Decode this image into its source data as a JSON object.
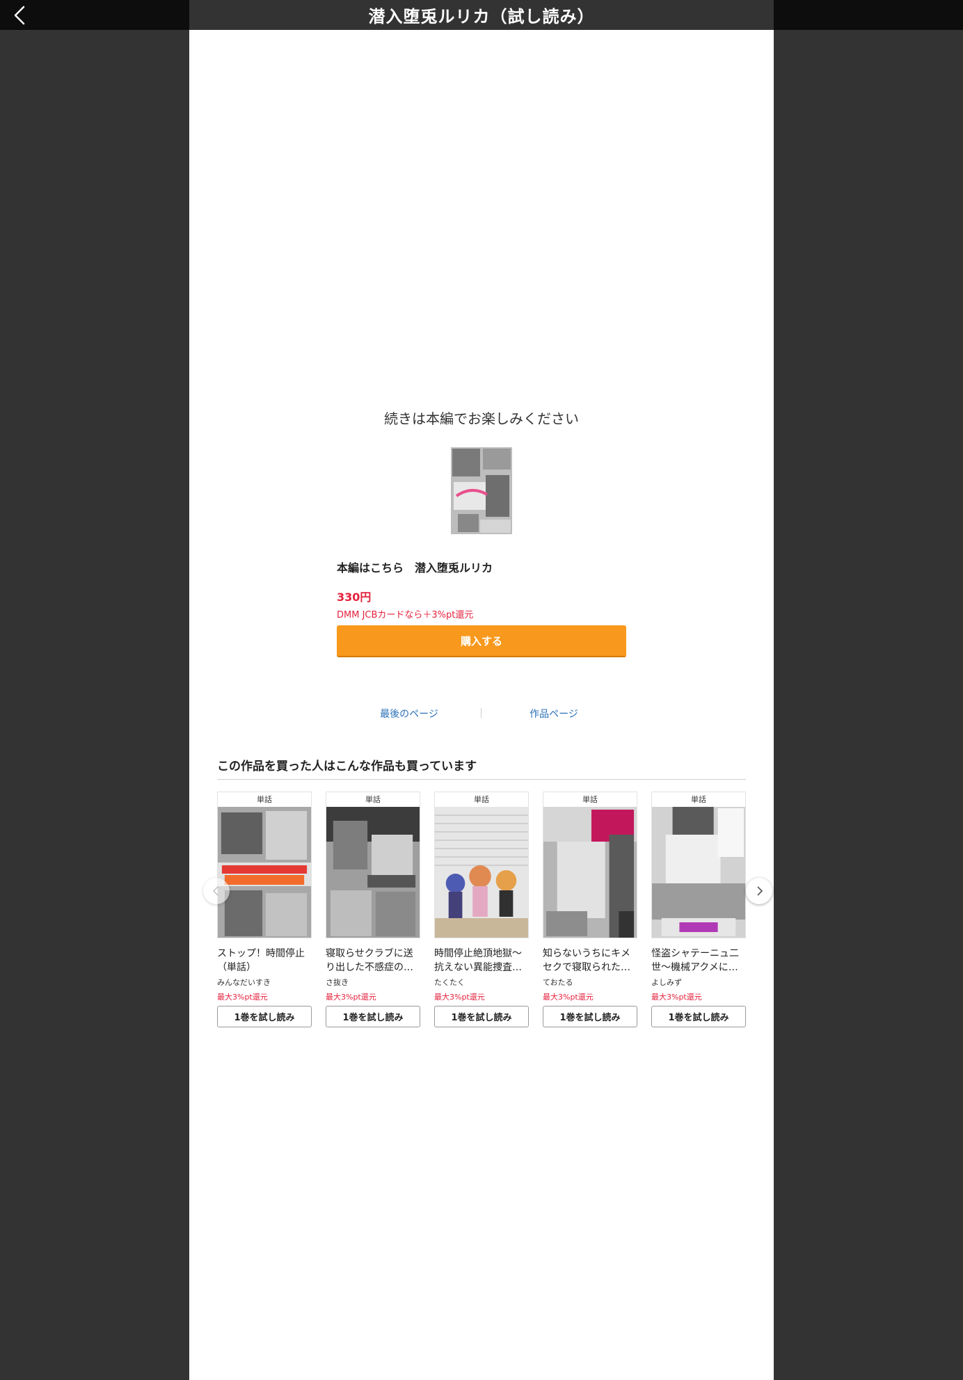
{
  "header": {
    "title": "潜入堕兎ルリカ（試し読み）"
  },
  "end_section": {
    "message": "続きは本編でお楽しみください",
    "heading": "本編はこちら　潜入堕兎ルリカ",
    "price": "330円",
    "card_note": "DMM JCBカードなら＋3%pt還元",
    "buy_label": "購入する",
    "last_page_link": "最後のページ",
    "work_page_link": "作品ページ"
  },
  "recommend": {
    "title": "この作品を買った人はこんな作品も買っています",
    "items": [
      {
        "tag": "単話",
        "name": "ストップ！時間停止（単話）",
        "author": "みんなだいすき",
        "points": "最大3%pt還元",
        "trial": "1巻を試し読み"
      },
      {
        "tag": "単話",
        "name": "寝取らせクラブに送り出した不感症の…",
        "author": "さ抜き",
        "points": "最大3%pt還元",
        "trial": "1巻を試し読み"
      },
      {
        "tag": "単話",
        "name": "時間停止絶頂地獄〜抗えない異能捜査…",
        "author": "たくたく",
        "points": "最大3%pt還元",
        "trial": "1巻を試し読み"
      },
      {
        "tag": "単話",
        "name": "知らないうちにキメセクで寝取られた…",
        "author": "ておたる",
        "points": "最大3%pt還元",
        "trial": "1巻を試し読み"
      },
      {
        "tag": "単話",
        "name": "怪盗シャテーニュ二世〜機械アクメに…",
        "author": "よしみず",
        "points": "最大3%pt還元",
        "trial": "1巻を試し読み"
      }
    ]
  },
  "colors": {
    "accent": "#f8991d",
    "price_red": "#e5223d",
    "link_blue": "#2b71b8"
  }
}
